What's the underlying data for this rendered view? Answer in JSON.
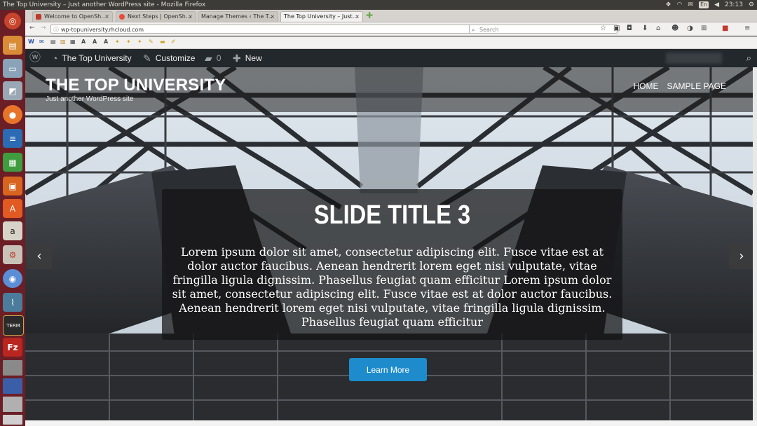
{
  "top_panel": {
    "window_title": "The Top University – Just another WordPress site - Mozilla Firefox",
    "keyboard": "En",
    "time": "23:13"
  },
  "browser": {
    "tabs": [
      {
        "label": "Welcome to OpenSh…",
        "favicon_color": "#c0392b"
      },
      {
        "label": "Next Steps | OpenSh…",
        "favicon_color": "#e74c3c"
      },
      {
        "label": "Manage Themes ‹ The T…",
        "favicon_color": "#d6d3ce"
      },
      {
        "label": "The Top University – Just…",
        "favicon_color": "#d6d3ce"
      }
    ],
    "close_glyph": "×",
    "url": "wp-topuniversity.rhcloud.com",
    "search_placeholder": "Search"
  },
  "admin_bar": {
    "site_name": "The Top University",
    "customize": "Customize",
    "comments_count": "0",
    "new_label": "New"
  },
  "site": {
    "title": "THE TOP UNIVERSITY",
    "tagline": "Just another WordPress site",
    "nav": [
      "HOME",
      "SAMPLE PAGE"
    ]
  },
  "slider": {
    "slide_title": "SLIDE TITLE 3",
    "slide_text": "Lorem ipsum dolor sit amet, consectetur adipiscing elit. Fusce vitae est at dolor auctor faucibus. Aenean hendrerit lorem eget nisi vulputate, vitae fringilla ligula dignissim. Phasellus feugiat quam efficitur Lorem ipsum dolor sit amet, consectetur adipiscing elit. Fusce vitae est at dolor auctor faucibus. Aenean hendrerit lorem eget nisi vulputate, vitae fringilla ligula dignissim. Phasellus feugiat quam efficitur",
    "button_label": "Learn More",
    "prev_glyph": "‹",
    "next_glyph": "›"
  },
  "colors": {
    "launcher": "#6b1e25",
    "admin_bar": "#23282d",
    "button": "#1e8ccc"
  },
  "launcher_icons": [
    "ubuntu-dash-icon",
    "files-icon",
    "computer-icon",
    "screenshot-icon",
    "firefox-icon",
    "writer-icon",
    "calc-icon",
    "impress-icon",
    "software-center-icon",
    "amazon-icon",
    "settings-icon",
    "chromium-icon",
    "system-monitor-icon",
    "terminal-icon",
    "filezilla-icon"
  ]
}
